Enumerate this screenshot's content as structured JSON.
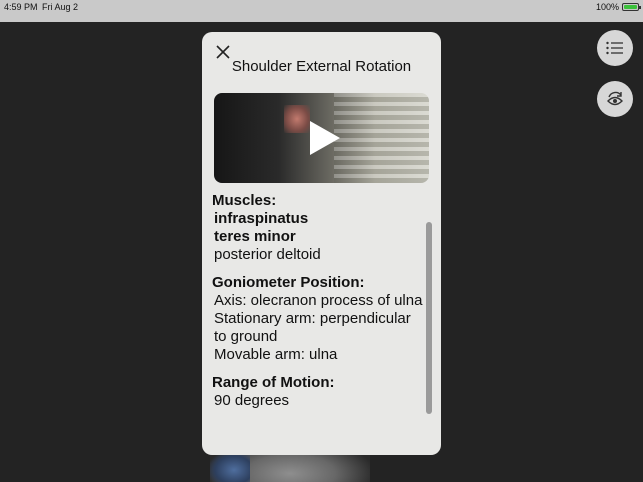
{
  "status_bar": {
    "time": "4:59 PM",
    "date": "Fri Aug 2",
    "battery_percent": "100%",
    "battery_level": 1.0,
    "battery_color": "#3cc23c"
  },
  "toolbar": {
    "menu_icon": "list-icon",
    "view_icon": "rotate-eye-icon"
  },
  "panel": {
    "close_icon": "close-icon",
    "title": "Shoulder External Rotation",
    "video": {
      "play_icon": "play-icon"
    },
    "muscles": {
      "heading": "Muscles:",
      "items": [
        {
          "name": "infraspinatus",
          "emphasis": true
        },
        {
          "name": "teres minor",
          "emphasis": true
        },
        {
          "name": "posterior deltoid",
          "emphasis": false
        }
      ]
    },
    "goniometer": {
      "heading": "Goniometer Position:",
      "axis": "Axis: olecranon process of ulna",
      "stationary_arm": "Stationary arm: perpendicular to ground",
      "movable_arm": "Movable arm: ulna"
    },
    "range_of_motion": {
      "heading": "Range of Motion:",
      "value": "90 degrees"
    }
  },
  "colors": {
    "background": "#232323",
    "panel": "#e8e8e6",
    "status_bar": "#c9c9c9"
  }
}
